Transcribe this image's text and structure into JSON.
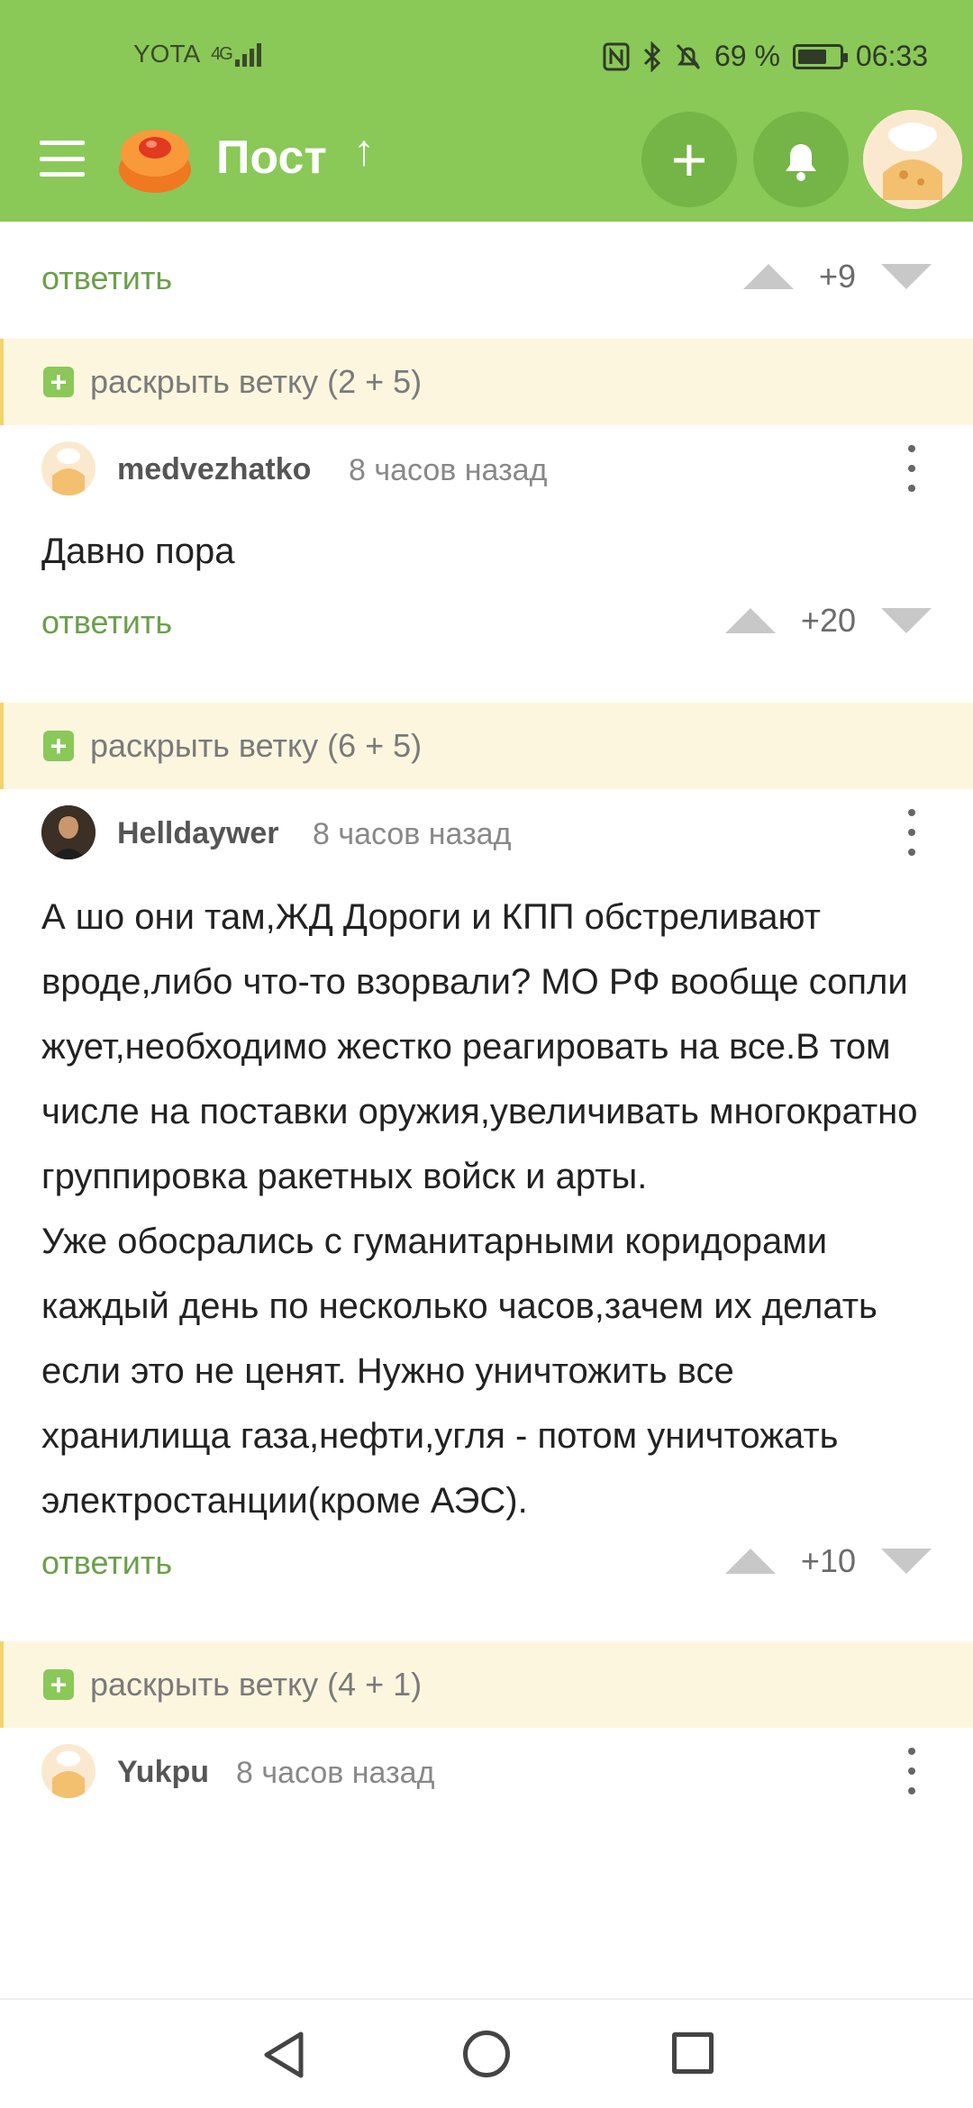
{
  "status": {
    "carrier": "YOTA",
    "network": "4G",
    "battery": "69 %",
    "battery_level": 0.69,
    "time": "06:33"
  },
  "appbar": {
    "title": "Пост",
    "up_arrow": "↑",
    "add_glyph": "+"
  },
  "top_reply": {
    "label": "ответить",
    "score": "+9"
  },
  "comments": [
    {
      "branch": "раскрыть ветку (2 + 5)",
      "user": "medvezhatko",
      "time": "8 часов назад",
      "text": "Давно пора",
      "reply": "ответить",
      "score": "+20"
    },
    {
      "branch": "раскрыть ветку (6 + 5)",
      "user": "Helldaywer",
      "time": "8 часов назад",
      "text": "А шо они там,ЖД Дороги и КПП обстреливают вроде,либо что-то взорвали? МО РФ вообще сопли жует,необходимо жестко реагировать на все.В том числе на поставки оружия,увеличивать многократно группировка ракетных войск и арты.\nУже обосрались с гуманитарными коридорами каждый день по несколько часов,зачем их делать если это не ценят. Нужно уничтожить все хранилища газа,нефти,угля  - потом уничтожать электростанции(кроме АЭС).",
      "reply": "ответить",
      "score": "+10"
    },
    {
      "branch": "раскрыть ветку (4 + 1)",
      "user": "Yukpu",
      "time": "8 часов назад"
    }
  ],
  "colors": {
    "brand_green": "#8ac858",
    "link_green": "#6aa04a",
    "branch_bg": "#fdf6df"
  },
  "icons": [
    "menu-icon",
    "pikabu-logo",
    "plus-icon",
    "bell-icon",
    "vote-up-icon",
    "vote-down-icon",
    "more-vert-icon",
    "back-icon",
    "home-icon",
    "recents-icon"
  ]
}
